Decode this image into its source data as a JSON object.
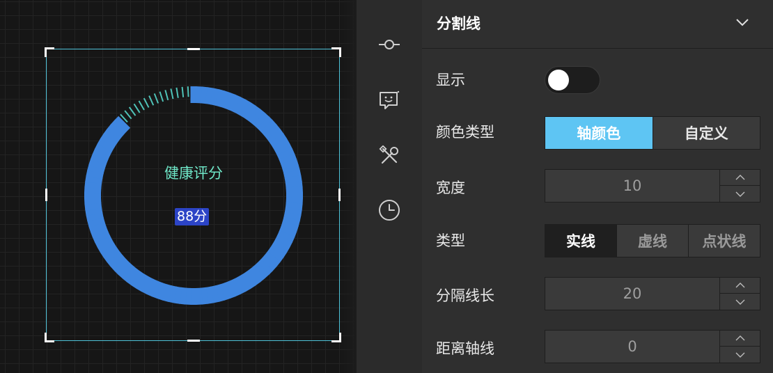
{
  "canvas": {
    "gauge": {
      "title": "健康评分",
      "value_text": "88分",
      "value": 88,
      "max": 100,
      "ring_color": "#3f86e0",
      "tick_color": "#4fc3b8",
      "title_color": "#6fe7c8"
    }
  },
  "sidebar_icons": [
    {
      "name": "connector-icon"
    },
    {
      "name": "chat-face-icon"
    },
    {
      "name": "tools-icon"
    },
    {
      "name": "clock-icon"
    }
  ],
  "panel": {
    "section_title": "分割线",
    "rows": {
      "show": {
        "label": "显示",
        "enabled": false
      },
      "color_type": {
        "label": "颜色类型",
        "options": [
          "轴颜色",
          "自定义"
        ],
        "selected": "轴颜色"
      },
      "width": {
        "label": "宽度",
        "value": "10"
      },
      "type": {
        "label": "类型",
        "options": [
          "实线",
          "虚线",
          "点状线"
        ],
        "selected": "实线"
      },
      "split_length": {
        "label": "分隔线长",
        "value": "20"
      },
      "axis_distance": {
        "label": "距离轴线",
        "value": "0"
      }
    },
    "accent_color": "#5ec5f3"
  }
}
